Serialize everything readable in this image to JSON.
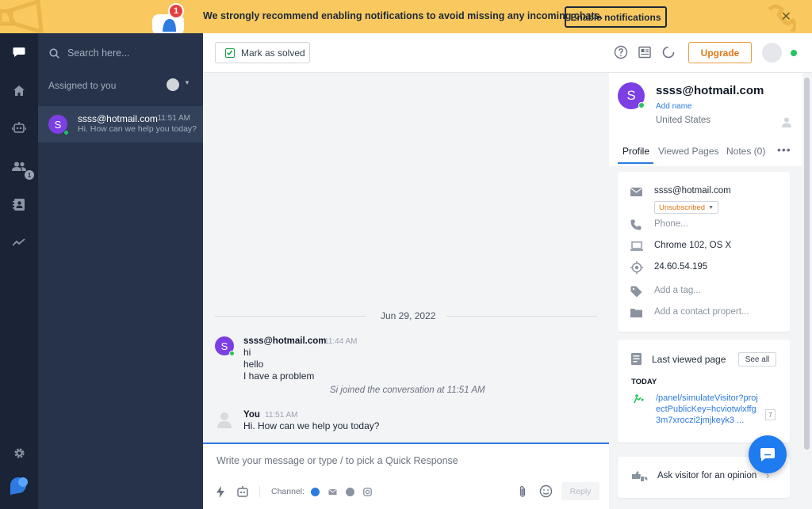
{
  "banner": {
    "badge": "1",
    "message": "We strongly recommend enabling notifications to avoid missing any incoming chats.",
    "enable_label": "Enable notifications",
    "close": "✕"
  },
  "sidebar": {
    "search_placeholder": "Search here...",
    "assigned_label": "Assigned to you",
    "team_badge": "1",
    "conversations": [
      {
        "initial": "S",
        "name": "ssss@hotmail.com",
        "time": "11:51 AM",
        "preview": "Hi. How can we help you today?"
      }
    ]
  },
  "topbar": {
    "mark_solved": "Mark as solved",
    "upgrade": "Upgrade"
  },
  "chat": {
    "date": "Jun 29, 2022",
    "messages": [
      {
        "initial": "S",
        "author": "ssss@hotmail.com",
        "time": "11:44 AM",
        "lines": [
          "hi",
          "hello",
          "I have a problem"
        ]
      },
      {
        "author": "You",
        "time": "11:51 AM",
        "lines": [
          "Hi. How can we help you today?"
        ]
      }
    ],
    "system_note": "Si joined the conversation at 11:51 AM"
  },
  "composer": {
    "placeholder": "Write your message or type / to pick a Quick Response",
    "channel_label": "Channel:",
    "reply": "Reply"
  },
  "profile": {
    "initial": "S",
    "name": "ssss@hotmail.com",
    "add_name": "Add name",
    "country": "United States",
    "tabs": [
      "Profile",
      "Viewed Pages",
      "Notes (0)"
    ],
    "more": "•••",
    "email": "ssss@hotmail.com",
    "subscription": "Unsubscribed",
    "phone_placeholder": "Phone...",
    "browser": "Chrome 102, OS X",
    "ip": "24.60.54.195",
    "tag_placeholder": "Add a tag...",
    "property_placeholder": "Add a contact propert..."
  },
  "last_viewed": {
    "title": "Last viewed page",
    "see_all": "See all",
    "today": "TODAY",
    "link": "/panel/simulateVisitor?projectPublicKey=hcviotwlxffg3m7xroczi2jmjkeyk3 ...",
    "count": "7"
  },
  "opinion": {
    "label": "Ask visitor for an opinion"
  },
  "colors": {
    "accent": "#2d7ae0",
    "banner": "#f9c960",
    "nav": "#1a2436",
    "list": "#26334a",
    "avatar": "#7b3fe4",
    "online": "#22c55e",
    "upgrade": "#f29a3a"
  }
}
